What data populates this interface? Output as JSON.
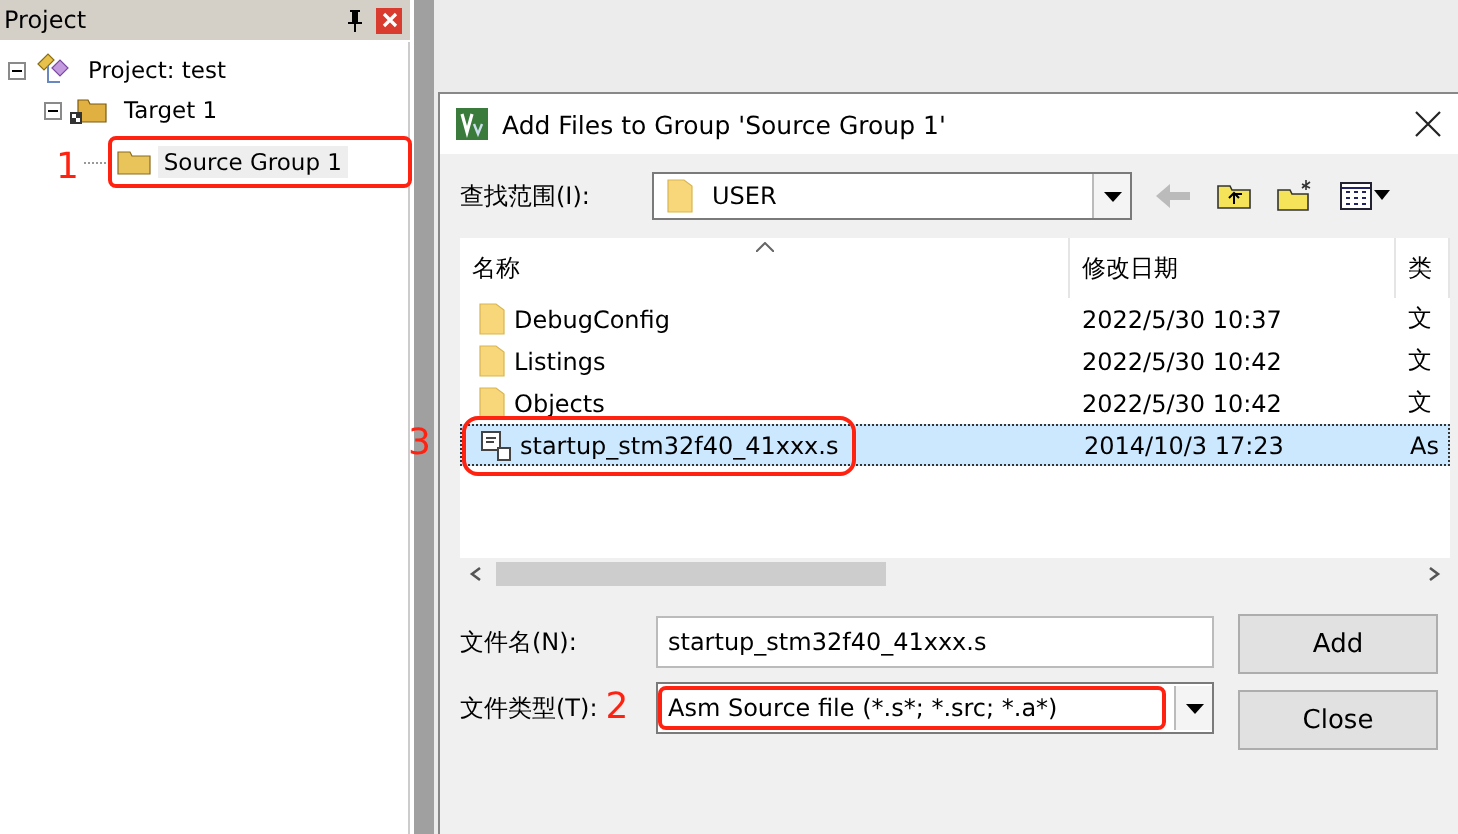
{
  "project_panel": {
    "title": "Project",
    "tree": [
      {
        "label": "Project: test",
        "kind": "project",
        "expanded": true,
        "selected": false,
        "children": [
          {
            "label": "Target 1",
            "kind": "target",
            "expanded": true,
            "selected": false,
            "children": [
              {
                "label": "Source Group 1",
                "kind": "group",
                "selected": true,
                "annotation": "1"
              }
            ]
          }
        ]
      }
    ]
  },
  "dialog": {
    "title": "Add Files to Group 'Source Group 1'",
    "look_in": {
      "label": "查找范围(I):",
      "value": "USER"
    },
    "file_list": {
      "columns": [
        "名称",
        "修改日期",
        "类"
      ],
      "rows": [
        {
          "kind": "folder",
          "name": "DebugConfig",
          "date": "2022/5/30 10:37",
          "type": "文",
          "selected": false
        },
        {
          "kind": "folder",
          "name": "Listings",
          "date": "2022/5/30 10:42",
          "type": "文",
          "selected": false
        },
        {
          "kind": "folder",
          "name": "Objects",
          "date": "2022/5/30 10:42",
          "type": "文",
          "selected": false
        },
        {
          "kind": "file",
          "name": "startup_stm32f40_41xxx.s",
          "date": "2014/10/3 17:23",
          "type": "As",
          "selected": true,
          "annotation": "3"
        }
      ]
    },
    "file_name": {
      "label": "文件名(N):",
      "value": "startup_stm32f40_41xxx.s"
    },
    "file_type": {
      "label": "文件类型(T):",
      "value": "Asm Source file (*.s*; *.src; *.a*)",
      "annotation": "2"
    },
    "buttons": [
      "Add",
      "Close"
    ]
  }
}
